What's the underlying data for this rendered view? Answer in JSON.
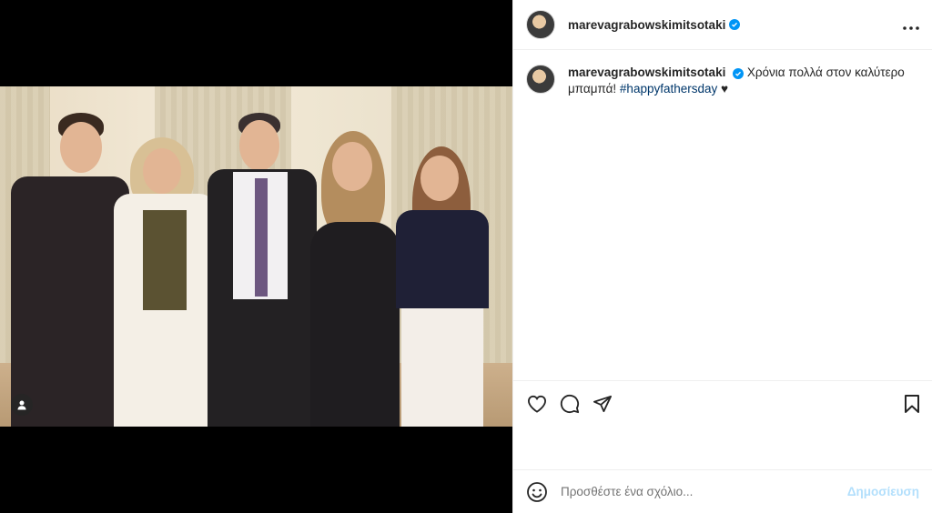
{
  "post": {
    "username": "marevagrabowskimitsotaki",
    "verified": true,
    "more_icon": "ellipsis-icon",
    "caption_text": "Χρόνια πολλά στον καλύτερο μπαμπά! ",
    "caption_hashtag": "#happyfathersday",
    "caption_emoji": "♥",
    "tag_icon": "user-tag-icon"
  },
  "actions": {
    "like_icon": "heart-icon",
    "comment_icon": "comment-icon",
    "share_icon": "paper-plane-icon",
    "save_icon": "bookmark-icon"
  },
  "comment_box": {
    "emoji_icon": "smiley-icon",
    "placeholder": "Προσθέστε ένα σχόλιο...",
    "post_label": "Δημοσίευση"
  },
  "colors": {
    "verified_blue": "#0095f6",
    "hashtag": "#00376b",
    "post_disabled": "#b2dffc"
  }
}
